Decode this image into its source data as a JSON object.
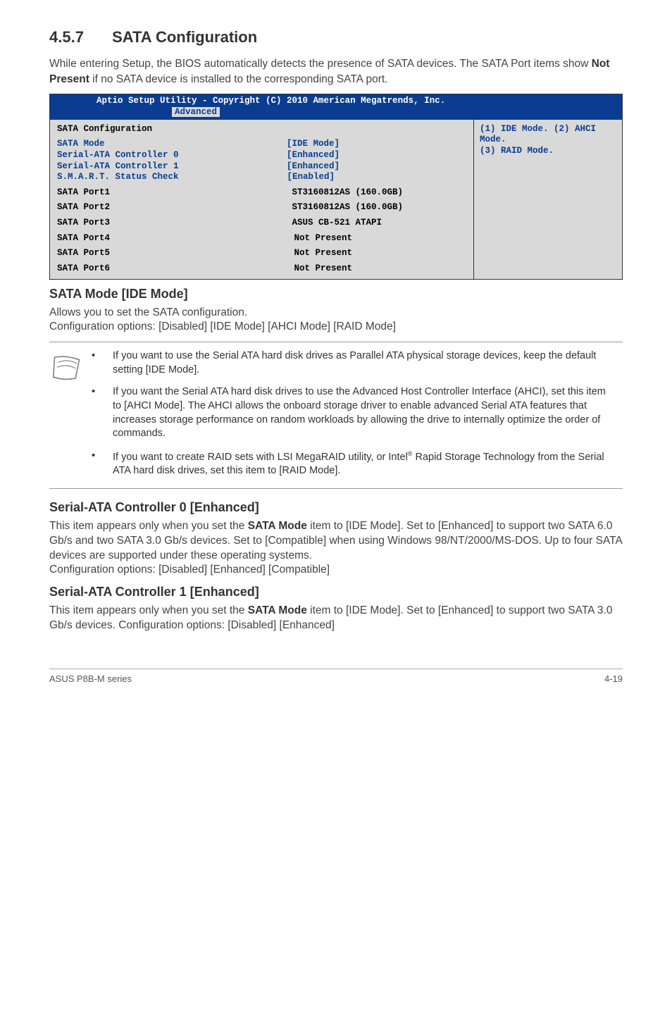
{
  "section": {
    "number": "4.5.7",
    "title": "SATA Configuration"
  },
  "intro": "While entering Setup, the BIOS automatically detects the presence of SATA devices. The SATA Port items show ",
  "intro_bold": "Not Present",
  "intro_after": " if no SATA device is installed to the corresponding SATA port.",
  "bios": {
    "header_pre": "Aptio Setup Utility - Copyright (C) 2010 American Megatrends, Inc.",
    "tab": "Advanced",
    "left_title": "SATA Configuration",
    "rows": [
      {
        "label": "SATA Mode",
        "value": "[IDE Mode]",
        "cls": "blue"
      },
      {
        "label": "Serial-ATA Controller 0",
        "value": "[Enhanced]",
        "cls": "blue"
      },
      {
        "label": "Serial-ATA Controller 1",
        "value": "[Enhanced]",
        "cls": "blue"
      },
      {
        "label": "S.M.A.R.T. Status Check",
        "value": "[Enabled]",
        "cls": "blue"
      }
    ],
    "ports": [
      {
        "label": "SATA Port1",
        "value": "ST3160812AS (160.0GB)"
      },
      {
        "label": "SATA Port2",
        "value": "ST3160812AS (160.0GB)"
      },
      {
        "label": "SATA Port3",
        "value": "ASUS CB-521 ATAPI"
      },
      {
        "label": "SATA Port4",
        "value": "Not Present"
      },
      {
        "label": "SATA Port5",
        "value": "Not Present"
      },
      {
        "label": "SATA Port6",
        "value": "Not Present"
      }
    ],
    "help_line1": "(1) IDE Mode. (2) AHCI Mode.",
    "help_line2": "(3) RAID Mode."
  },
  "sata_mode": {
    "heading": "SATA Mode [IDE Mode]",
    "line1": "Allows you to set the SATA configuration.",
    "line2": "Configuration options: [Disabled] [IDE Mode] [AHCI Mode] [RAID Mode]"
  },
  "notes": {
    "item1": "If you want to use the Serial ATA hard disk drives as Parallel ATA physical storage devices, keep the default setting [IDE Mode].",
    "item2": "If you want the Serial ATA hard disk drives to use the Advanced Host Controller Interface (AHCI), set this item to [AHCI Mode]. The AHCI allows the onboard storage driver to enable advanced Serial ATA features that increases storage performance on random workloads by allowing the drive to internally optimize the order of commands.",
    "item3_pre": "If you want to create RAID sets with LSI MegaRAID utility, or Intel",
    "item3_sup": "®",
    "item3_post": " Rapid Storage Technology from the Serial ATA hard disk drives, set this item to [RAID Mode]."
  },
  "ctrl0": {
    "heading": "Serial-ATA Controller 0 [Enhanced]",
    "p1_pre": "This item appears only when you set the ",
    "p1_bold": "SATA Mode",
    "p1_post": " item to [IDE Mode]. Set to [Enhanced] to support two SATA 6.0 Gb/s and two SATA 3.0 Gb/s devices. Set to [Compatible] when using Windows 98/NT/2000/MS-DOS. Up to four SATA devices are supported under these operating systems.",
    "p2": "Configuration options: [Disabled] [Enhanced] [Compatible]"
  },
  "ctrl1": {
    "heading": "Serial-ATA Controller 1 [Enhanced]",
    "p1_pre": "This item appears only when you set the ",
    "p1_bold": "SATA Mode",
    "p1_post": " item to [IDE Mode]. Set to [Enhanced] to support two SATA 3.0 Gb/s devices. Configuration options: [Disabled] [Enhanced]"
  },
  "footer": {
    "left": "ASUS P8B-M series",
    "right": "4-19"
  }
}
